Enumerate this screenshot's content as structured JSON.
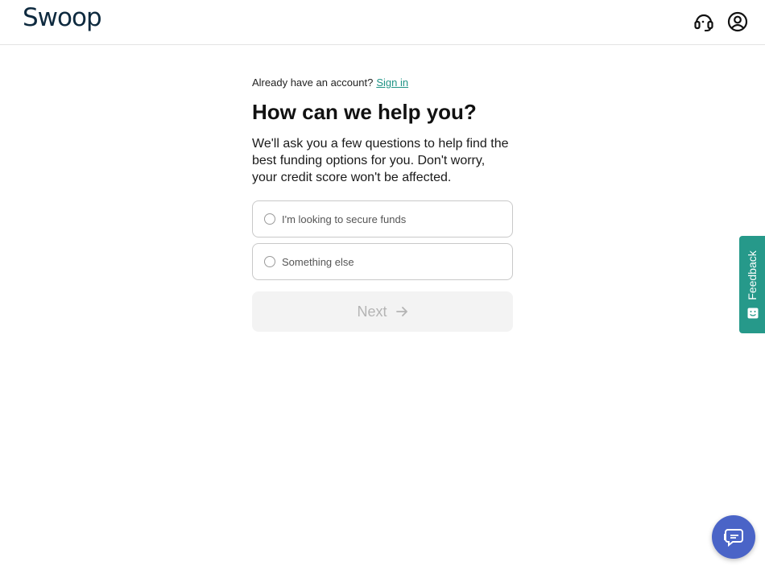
{
  "header": {
    "logo_text": "Swoop",
    "support_icon": "headset-icon",
    "account_icon": "user-circle-icon"
  },
  "main": {
    "signin_prompt": "Already have an account?",
    "signin_link": "Sign in",
    "title": "How can we help you?",
    "subtitle": "We'll ask you a few questions to help find the best funding options for you. Don't worry, your credit score won't be affected.",
    "options": [
      {
        "label": "I'm looking to secure funds",
        "selected": false
      },
      {
        "label": "Something else",
        "selected": false
      }
    ],
    "next_label": "Next",
    "next_disabled": true
  },
  "feedback": {
    "label": "Feedback",
    "icon": "smiley-square-icon"
  },
  "chat": {
    "icon": "chat-bubbles-icon"
  },
  "colors": {
    "brand": "#0e2a3f",
    "accent": "#1f9385",
    "feedback_bg": "#26998a",
    "chat_bg": "#4a64c7",
    "disabled_bg": "#f3f3f3",
    "disabled_text": "#b4b4b4"
  }
}
